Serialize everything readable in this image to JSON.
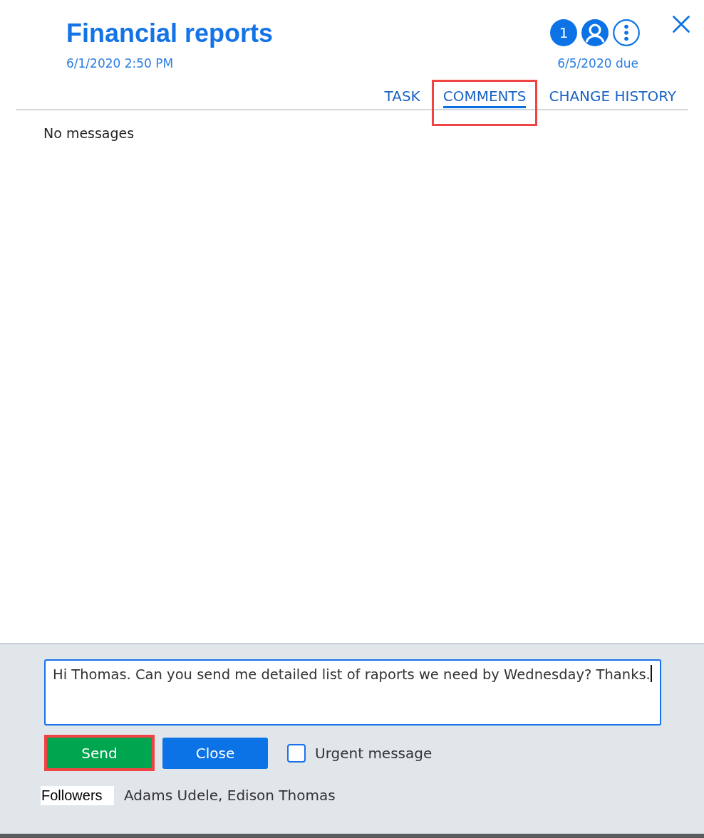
{
  "header": {
    "title": "Financial reports",
    "created": "6/1/2020 2:50 PM",
    "badge": "1",
    "due": "6/5/2020 due"
  },
  "tabs": [
    {
      "label": "TASK",
      "selected": false,
      "highlighted": false
    },
    {
      "label": "COMMENTS",
      "selected": true,
      "highlighted": true
    },
    {
      "label": "CHANGE HISTORY",
      "selected": false,
      "highlighted": false
    }
  ],
  "empty_message": "No messages",
  "composer": {
    "value": "Hi Thomas. Can you send me detailed list of raports we need by Wednesday? Thanks.",
    "buttons": [
      {
        "kind": "send",
        "label": "Send",
        "highlighted": true
      },
      {
        "kind": "close",
        "label": "Close",
        "highlighted": false
      }
    ],
    "urgent": {
      "label": "Urgent message",
      "checked": false
    }
  },
  "followers": {
    "label": "Followers",
    "names": "Adams Udele, Edison Thomas"
  }
}
